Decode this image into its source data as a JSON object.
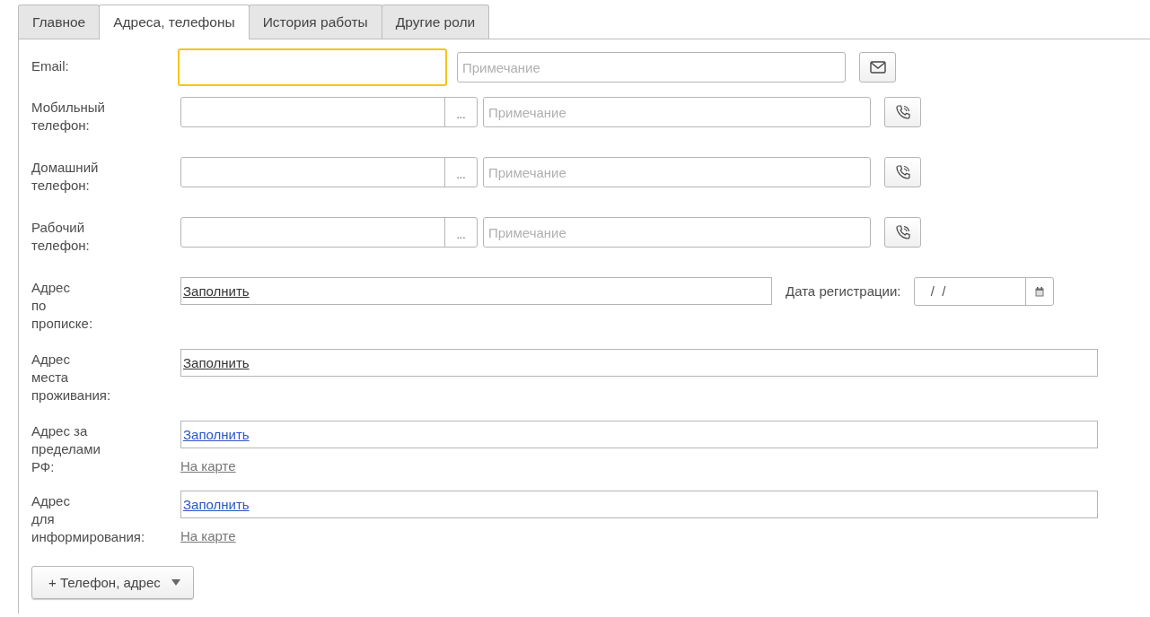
{
  "tabs": [
    {
      "label": "Главное",
      "selected": false
    },
    {
      "label": "Адреса, телефоны",
      "selected": true
    },
    {
      "label": "История работы",
      "selected": false
    },
    {
      "label": "Другие роли",
      "selected": false
    }
  ],
  "rows": [
    {
      "kind": "email",
      "label": "Email:",
      "focused": true,
      "note_placeholder": "Примечание"
    },
    {
      "kind": "phone",
      "label": "Мобильный\nтелефон:",
      "focused": false,
      "choice": "...",
      "note_placeholder": "Примечание"
    },
    {
      "kind": "phone",
      "label": "Домашний\nтелефон:",
      "focused": false,
      "choice": "...",
      "note_placeholder": "Примечание"
    },
    {
      "kind": "phone",
      "label": "Рабочий\nтелефон:",
      "focused": false,
      "choice": "...",
      "note_placeholder": "Примечание"
    },
    {
      "kind": "address",
      "label": "Адрес\nпо\nпрописке:",
      "link": "Заполнить",
      "highlighted": false,
      "date_label": "Дата регистрации:",
      "date_value": " /  /"
    },
    {
      "kind": "address",
      "label": "Адрес\nместа\nпроживания:",
      "link": "Заполнить",
      "highlighted": false
    },
    {
      "kind": "address",
      "label": "Адрес за\nпределами\nРФ:",
      "link": "Заполнить",
      "highlighted": true,
      "map_link": "На карте"
    },
    {
      "kind": "address",
      "label": "Адрес\nдля\nинформирования:",
      "link": "Заполнить",
      "highlighted": true,
      "map_link": "На карте"
    }
  ],
  "add_button": "+ Телефон, адрес"
}
